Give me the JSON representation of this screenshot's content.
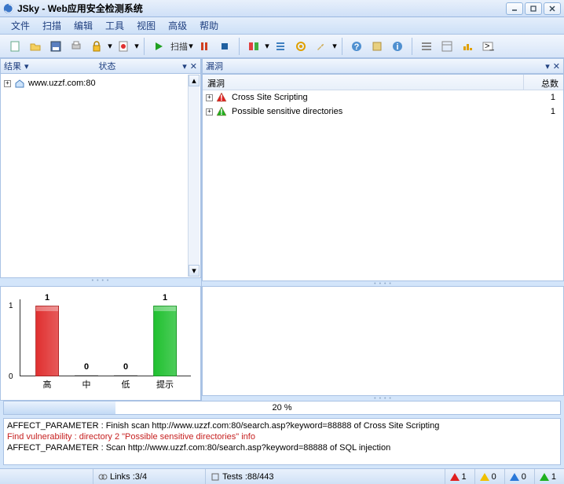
{
  "window": {
    "title": "JSky - Web应用安全检测系统"
  },
  "menu": [
    "文件",
    "扫描",
    "编辑",
    "工具",
    "视图",
    "高级",
    "帮助"
  ],
  "toolbar": {
    "scan_label": "扫描"
  },
  "left_panel": {
    "title": "结果",
    "col_status": "状态",
    "target": "www.uzzf.com:80"
  },
  "vuln_panel": {
    "title": "漏洞",
    "col_name": "漏洞",
    "col_count": "总数",
    "rows": [
      {
        "name": "Cross Site Scripting",
        "count": 1,
        "severity": "high"
      },
      {
        "name": "Possible sensitive directories",
        "count": 1,
        "severity": "info"
      }
    ]
  },
  "chart_data": {
    "type": "bar",
    "categories": [
      "高",
      "中",
      "低",
      "提示"
    ],
    "values": [
      1,
      0,
      0,
      1
    ],
    "ylim": [
      0,
      1
    ],
    "colors": [
      "#e03030",
      "#f0d020",
      "#2a78d8",
      "#20c030"
    ]
  },
  "progress": {
    "percent": 20,
    "label": "20 %"
  },
  "log": [
    {
      "text": "AFFECT_PARAMETER : Finish scan http://www.uzzf.com:80/search.asp?keyword=88888 of Cross Site Scripting",
      "kind": "normal"
    },
    {
      "text": "Find vulnerability : directory 2 \"Possible sensitive directories\" info",
      "kind": "red"
    },
    {
      "text": "AFFECT_PARAMETER : Scan http://www.uzzf.com:80/search.asp?keyword=88888 of SQL injection",
      "kind": "normal"
    }
  ],
  "status": {
    "links": "Links :3/4",
    "tests": "Tests :88/443",
    "counts": {
      "high": 1,
      "med": 0,
      "low": 0,
      "info": 1
    }
  }
}
